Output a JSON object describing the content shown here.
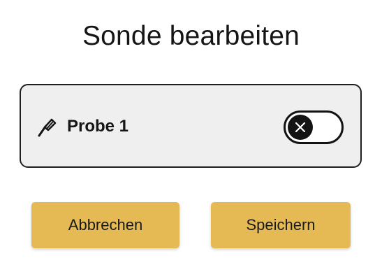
{
  "dialog": {
    "title": "Sonde bearbeiten"
  },
  "probe": {
    "name": "Probe 1",
    "icon": "probe-icon",
    "enabled": false,
    "toggle_icon": "close-icon"
  },
  "actions": {
    "cancel_label": "Abbrechen",
    "save_label": "Speichern"
  },
  "colors": {
    "accent": "#e5ba55",
    "card_background": "#efefef",
    "toggle_dark": "#141414"
  }
}
